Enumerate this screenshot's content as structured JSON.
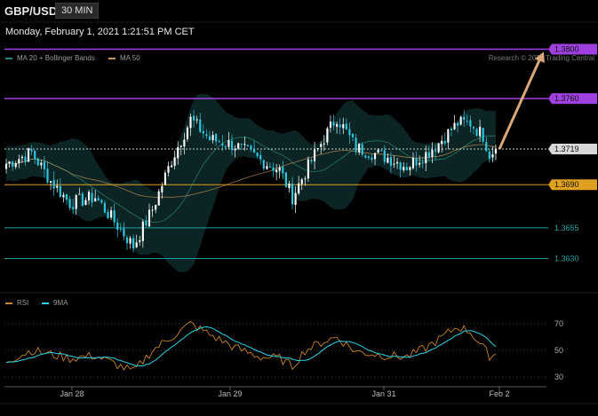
{
  "header": {
    "symbol": "GBP/USD",
    "timeframe": "30 MIN",
    "timestamp": "Monday, February 1, 2021 1:21:51 PM CET"
  },
  "price_legend": {
    "ma20": {
      "label": "MA 20 + Bollinger Bands",
      "color": "#1f8a88"
    },
    "ma50": {
      "label": "MA 50",
      "color": "#c8965a"
    }
  },
  "copyright": "Research © 2021 Trading Central",
  "rsi_legend": {
    "rsi": {
      "label": "RSI",
      "color": "#c8822a"
    },
    "ma9": {
      "label": "9MA",
      "color": "#2ad4e8"
    }
  },
  "colors": {
    "up": "#ffffff",
    "down": "#2ec8e0",
    "resistance": "#a040e0",
    "support_strong": "#e0a020",
    "support": "#1fa0a0",
    "current": "#d0d0d0",
    "projection": "#d8a878"
  },
  "chart_data": [
    {
      "type": "candlestick",
      "title": "GBP/USD",
      "ylim": [
        1.3603,
        1.3822
      ],
      "x_ticks": [
        "Jan 28",
        "Jan 29",
        "Jan 31",
        "Feb 2"
      ],
      "levels": [
        {
          "value": 1.38,
          "label": "1.3800",
          "kind": "resistance"
        },
        {
          "value": 1.376,
          "label": "1.3760",
          "kind": "resistance"
        },
        {
          "value": 1.3719,
          "label": "1.3719",
          "kind": "current"
        },
        {
          "value": 1.369,
          "label": "1.3690",
          "kind": "support_strong"
        },
        {
          "value": 1.3655,
          "label": "1.3655",
          "kind": "support"
        },
        {
          "value": 1.363,
          "label": "1.3630",
          "kind": "support"
        }
      ],
      "projection": {
        "from": 1.3719,
        "to": 1.38
      },
      "key_points": [
        [
          0,
          1.3707
        ],
        [
          8,
          1.3716
        ],
        [
          14,
          1.3693
        ],
        [
          20,
          1.3675
        ],
        [
          28,
          1.368
        ],
        [
          40,
          1.364
        ],
        [
          46,
          1.367
        ],
        [
          52,
          1.371
        ],
        [
          58,
          1.3743
        ],
        [
          64,
          1.3727
        ],
        [
          72,
          1.3722
        ],
        [
          80,
          1.371
        ],
        [
          86,
          1.3702
        ],
        [
          90,
          1.368
        ],
        [
          94,
          1.37
        ],
        [
          100,
          1.3728
        ],
        [
          104,
          1.3745
        ],
        [
          110,
          1.372
        ],
        [
          120,
          1.3712
        ],
        [
          126,
          1.3705
        ],
        [
          132,
          1.3715
        ],
        [
          136,
          1.3724
        ],
        [
          142,
          1.374
        ],
        [
          146,
          1.374
        ],
        [
          150,
          1.373
        ],
        [
          152,
          1.3715
        ],
        [
          154,
          1.3719
        ]
      ]
    },
    {
      "type": "line",
      "title": "RSI",
      "ylim": [
        20,
        80
      ],
      "y_ticks": [
        70,
        50,
        30
      ],
      "series": [
        {
          "name": "RSI",
          "color": "#c8822a"
        },
        {
          "name": "9MA",
          "color": "#2ad4e8"
        }
      ],
      "key_points": [
        [
          0,
          42
        ],
        [
          8,
          50
        ],
        [
          14,
          47
        ],
        [
          20,
          44
        ],
        [
          28,
          46
        ],
        [
          40,
          34
        ],
        [
          46,
          50
        ],
        [
          52,
          60
        ],
        [
          58,
          70
        ],
        [
          64,
          62
        ],
        [
          72,
          52
        ],
        [
          80,
          45
        ],
        [
          86,
          44
        ],
        [
          90,
          38
        ],
        [
          94,
          50
        ],
        [
          100,
          57
        ],
        [
          104,
          60
        ],
        [
          110,
          49
        ],
        [
          120,
          46
        ],
        [
          126,
          45
        ],
        [
          132,
          52
        ],
        [
          136,
          58
        ],
        [
          142,
          68
        ],
        [
          146,
          64
        ],
        [
          150,
          52
        ],
        [
          152,
          46
        ],
        [
          154,
          47
        ]
      ]
    }
  ]
}
